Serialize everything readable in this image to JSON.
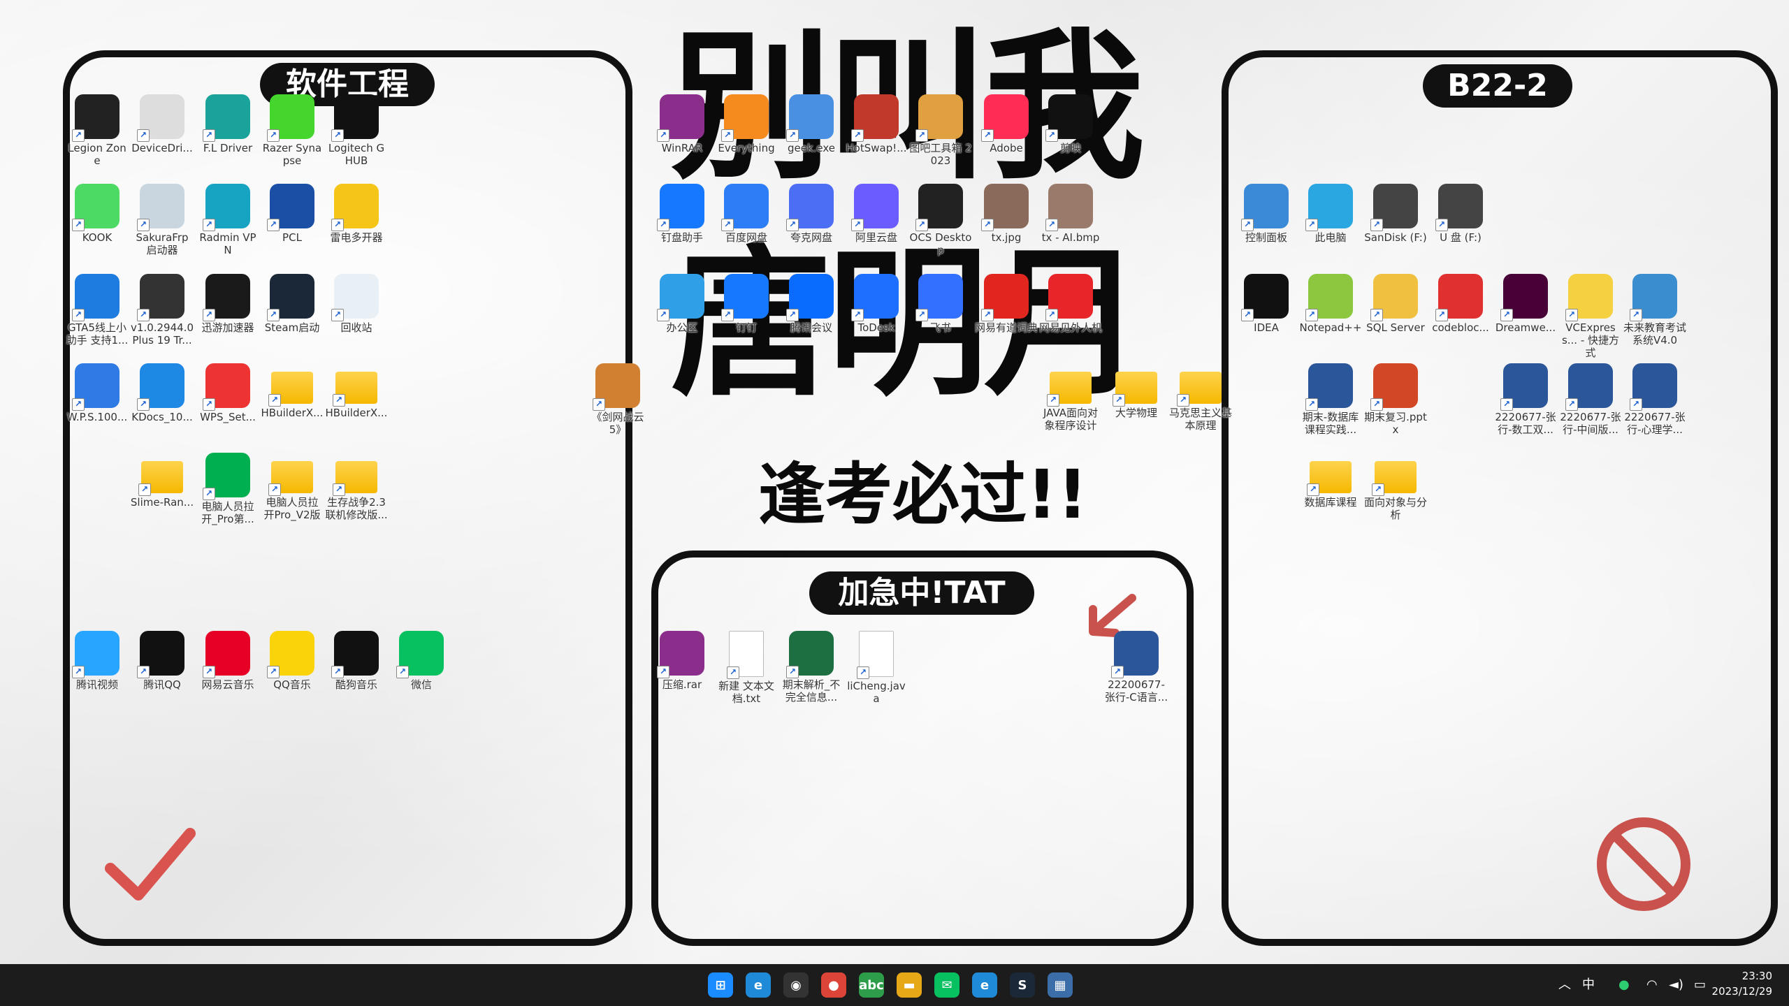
{
  "wallpaper": {
    "title_line1": "别叫我",
    "title_line2": "唐明月",
    "subtitle": "逢考必过!!",
    "panels": {
      "left": "软件工程",
      "right": "B22-2",
      "middle": "加急中!TAT"
    }
  },
  "icons_left": [
    {
      "label": "Legion Zone",
      "color": "#222"
    },
    {
      "label": "DeviceDri...",
      "color": "#ddd"
    },
    {
      "label": "F.L Driver",
      "color": "#1aa39a"
    },
    {
      "label": "Razer Synapse",
      "color": "#44d62c"
    },
    {
      "label": "Logitech G HUB",
      "color": "#111"
    },
    {
      "label": "KOOK",
      "color": "#4cd964"
    },
    {
      "label": "SakuraFrp 启动器",
      "color": "#c9d6e0"
    },
    {
      "label": "Radmin VPN",
      "color": "#17a4c2"
    },
    {
      "label": "PCL",
      "color": "#1b4fa6"
    },
    {
      "label": "雷电多开器",
      "color": "#f5c518"
    },
    {
      "label": "GTA5线上小助手 支持1...",
      "color": "#1e7be0"
    },
    {
      "label": "v1.0.2944.0 Plus 19 Tr...",
      "color": "#333"
    },
    {
      "label": "迅游加速器",
      "color": "#1a1a1a"
    },
    {
      "label": "Steam启动",
      "color": "#1b2838"
    },
    {
      "label": "回收站",
      "color": "#e9f0f5"
    },
    {
      "label": "W.P.S.100...",
      "color": "#2f7ae5"
    },
    {
      "label": "KDocs_10...",
      "color": "#1e88e5"
    },
    {
      "label": "WPS_Set...",
      "color": "#e33"
    },
    {
      "label": "HBuilderX...",
      "color": "folder"
    },
    {
      "label": "HBuilderX...",
      "color": "folder"
    },
    {
      "label": "Slime-Ran...",
      "color": "folder"
    },
    {
      "label": "电脑人员拉 开_Pro第...",
      "color": "#00b050"
    },
    {
      "label": "电脑人员拉 开Pro_V2版",
      "color": "folder"
    },
    {
      "label": "生存战争2.3 联机修改版...",
      "color": "folder"
    },
    {
      "label": "腾讯视频",
      "color": "#27a5ff"
    },
    {
      "label": "腾讯QQ",
      "color": "#111"
    },
    {
      "label": "网易云音乐",
      "color": "#e60026"
    },
    {
      "label": "QQ音乐",
      "color": "#fbd30b"
    },
    {
      "label": "酷狗音乐",
      "color": "#111"
    },
    {
      "label": "微信",
      "color": "#07c160"
    }
  ],
  "icons_center": [
    {
      "label": "WinRAR",
      "color": "#8b2e8b"
    },
    {
      "label": "Everything",
      "color": "#f58a1f"
    },
    {
      "label": "geek.exe",
      "color": "#4a90e2"
    },
    {
      "label": "HotSwap!...",
      "color": "#c0392b"
    },
    {
      "label": "图吧工具箱 2023",
      "color": "#e0a040"
    },
    {
      "label": "Adobe",
      "color": "#ff2d55"
    },
    {
      "label": "剪映",
      "color": "#111"
    },
    {
      "label": "钉盘助手",
      "color": "#1677ff"
    },
    {
      "label": "百度网盘",
      "color": "#2d7df6"
    },
    {
      "label": "夸克网盘",
      "color": "#4c6ef5"
    },
    {
      "label": "阿里云盘",
      "color": "#6a5cff"
    },
    {
      "label": "OCS Desktop",
      "color": "#222"
    },
    {
      "label": "tx.jpg",
      "color": "#8a6a5a"
    },
    {
      "label": "tx - AI.bmp",
      "color": "#9a7a6a"
    },
    {
      "label": "办公区",
      "color": "#2fa0e8"
    },
    {
      "label": "钉钉",
      "color": "#1677ff"
    },
    {
      "label": "腾讯会议",
      "color": "#0a6cff"
    },
    {
      "label": "ToDesk",
      "color": "#1e6fff"
    },
    {
      "label": "飞书",
      "color": "#3370ff"
    },
    {
      "label": "网易有道词典",
      "color": "#e0261e"
    },
    {
      "label": "网易见外人机",
      "color": "#e8262a"
    },
    {
      "label": "《剑网战云 5》",
      "color": "#d08030"
    },
    {
      "label": "JAVA面向对象程序设计",
      "color": "folder"
    },
    {
      "label": "大学物理",
      "color": "folder"
    },
    {
      "label": "马克思主义基本原理",
      "color": "folder"
    }
  ],
  "icons_middle_panel": [
    {
      "label": "压缩.rar",
      "color": "#8b2e8b"
    },
    {
      "label": "新建 文本文档.txt",
      "color": "doc"
    },
    {
      "label": "期末解析_不完全信息...",
      "color": "#1d6f42"
    },
    {
      "label": "liCheng.java",
      "color": "doc"
    },
    {
      "label": "22200677-张行-C语言...",
      "color": "#2b579a"
    }
  ],
  "icons_right": [
    {
      "label": "控制面板",
      "color": "#3b8ad8"
    },
    {
      "label": "此电脑",
      "color": "#2aa6e0"
    },
    {
      "label": "SanDisk (F:)",
      "color": "#444"
    },
    {
      "label": "U 盘 (F:)",
      "color": "#444"
    },
    {
      "label": "IDEA",
      "color": "#111"
    },
    {
      "label": "Notepad++",
      "color": "#8dc63f"
    },
    {
      "label": "SQL Server",
      "color": "#f0c040"
    },
    {
      "label": "codebloc...",
      "color": "#e03030"
    },
    {
      "label": "Dreamwe...",
      "color": "#470137"
    },
    {
      "label": "VCExpress... - 快捷方式",
      "color": "#f5d040"
    },
    {
      "label": "未来教育考试系统V4.0",
      "color": "#3a8ed0"
    },
    {
      "label": "期末-数据库课程实践...",
      "color": "#2b579a"
    },
    {
      "label": "期末复习.pptx",
      "color": "#d24726"
    },
    {
      "label": "2220677-张行-数工双...",
      "color": "#2b579a"
    },
    {
      "label": "2220677-张行-中间版...",
      "color": "#2b579a"
    },
    {
      "label": "2220677-张行-心理学...",
      "color": "#2b579a"
    },
    {
      "label": "数据库课程",
      "color": "folder"
    },
    {
      "label": "面向对象与分析",
      "color": "folder"
    }
  ],
  "taskbar": {
    "apps": [
      {
        "name": "windows-start-icon",
        "color": "#1a8cff",
        "glyph": "⊞"
      },
      {
        "name": "edge-icon",
        "color": "#1f8ad8",
        "glyph": "e"
      },
      {
        "name": "obs-icon",
        "color": "#333",
        "glyph": "◉"
      },
      {
        "name": "chrome-icon",
        "color": "#db4437",
        "glyph": "●"
      },
      {
        "name": "abc-icon",
        "color": "#2e9d4a",
        "glyph": "abc"
      },
      {
        "name": "file-explorer-icon",
        "color": "#e6a817",
        "glyph": "▬"
      },
      {
        "name": "wechat-icon",
        "color": "#07c160",
        "glyph": "✉"
      },
      {
        "name": "edge2-icon",
        "color": "#1f8ad8",
        "glyph": "e"
      },
      {
        "name": "steam-icon",
        "color": "#1b2838",
        "glyph": "S"
      },
      {
        "name": "monitor-icon",
        "color": "#3b6ea8",
        "glyph": "▦"
      }
    ],
    "tray_ime": "中",
    "time": "23:30",
    "date": "2023/12/29"
  }
}
